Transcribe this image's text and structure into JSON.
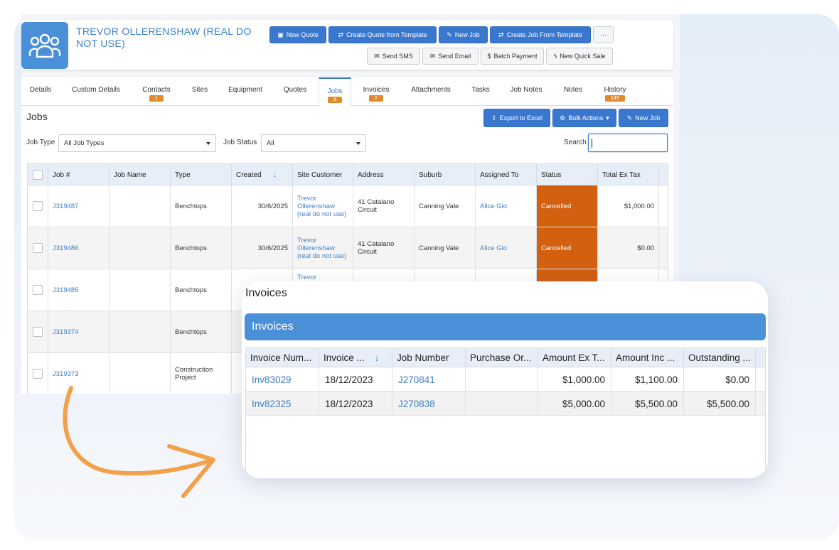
{
  "customer": {
    "name": "TREVOR OLLERENSHAW (REAL DO NOT USE)"
  },
  "header_buttons": {
    "new_quote": "New Quote",
    "create_quote_template": "Create Quote from Template",
    "new_job": "New Job",
    "create_job_template": "Create Job From Template",
    "more": "···",
    "send_sms": "Send SMS",
    "send_email": "Send Email",
    "batch_payment": "Batch Payment",
    "new_quick_sale": "New Quick Sale"
  },
  "tabs": [
    {
      "label": "Details",
      "badge": ""
    },
    {
      "label": "Custom Details",
      "badge": ""
    },
    {
      "label": "Contacts",
      "badge": "1"
    },
    {
      "label": "Sites",
      "badge": ""
    },
    {
      "label": "Equipment",
      "badge": ""
    },
    {
      "label": "Quotes",
      "badge": ""
    },
    {
      "label": "Jobs",
      "badge": "8"
    },
    {
      "label": "Invoices",
      "badge": "2"
    },
    {
      "label": "Attachments",
      "badge": ""
    },
    {
      "label": "Tasks",
      "badge": ""
    },
    {
      "label": "Job Notes",
      "badge": ""
    },
    {
      "label": "Notes",
      "badge": ""
    },
    {
      "label": "History",
      "badge": "145"
    }
  ],
  "jobs": {
    "title": "Jobs",
    "export_label": "Export to Excel",
    "bulk_label": "Bulk Actions",
    "new_job_label": "New Job",
    "filters": {
      "job_type_label": "Job Type",
      "job_type_value": "All Job Types",
      "job_status_label": "Job Status",
      "job_status_value": "All",
      "search_label": "Search"
    },
    "columns": [
      "Job #",
      "Job Name",
      "Type",
      "Created",
      "Site Customer",
      "Address",
      "Suburb",
      "Assigned To",
      "Status",
      "Total Ex Tax"
    ],
    "rows": [
      {
        "job": "J319487",
        "name": "",
        "type": "Benchtops",
        "created": "30/6/2025",
        "site": "Trevor Ollerenshaw (real do not use)",
        "address": "41 Catalano Circuit",
        "suburb": "Canning Vale",
        "assigned": "Alice Gio",
        "status": "Cancelled",
        "total": "$1,000.00"
      },
      {
        "job": "J319486",
        "name": "",
        "type": "Benchtops",
        "created": "30/6/2025",
        "site": "Trevor Ollerenshaw (real do not use)",
        "address": "41 Catalano Circuit",
        "suburb": "Canning Vale",
        "assigned": "Alice Gio",
        "status": "Cancelled",
        "total": "$0.00"
      },
      {
        "job": "J319485",
        "name": "",
        "type": "Benchtops",
        "created": "",
        "site": "Trevor",
        "address": "",
        "suburb": "",
        "assigned": "",
        "status": "",
        "total": ""
      },
      {
        "job": "J319374",
        "name": "",
        "type": "Benchtops",
        "created": "",
        "site": "",
        "address": "",
        "suburb": "",
        "assigned": "",
        "status": "",
        "total": ""
      },
      {
        "job": "J319373",
        "name": "",
        "type": "Construction Project",
        "created": "",
        "site": "",
        "address": "",
        "suburb": "",
        "assigned": "",
        "status": "",
        "total": ""
      }
    ]
  },
  "invoices": {
    "title": "Invoices",
    "bar_label": "Invoices",
    "columns": [
      "Invoice Num...",
      "Invoice ...",
      "Job Number",
      "Purchase Or...",
      "Amount Ex T...",
      "Amount Inc ...",
      "Outstanding ..."
    ],
    "rows": [
      {
        "invoice": "Inv83029",
        "date": "18/12/2023",
        "job": "J270841",
        "po": "",
        "ex": "$1,000.00",
        "inc": "$1,100.00",
        "outstanding": "$0.00"
      },
      {
        "invoice": "Inv82325",
        "date": "18/12/2023",
        "job": "J270838",
        "po": "",
        "ex": "$5,000.00",
        "inc": "$5,500.00",
        "outstanding": "$5,500.00"
      }
    ]
  },
  "colors": {
    "primary": "#3a78d0",
    "accent_orange": "#e08a2a",
    "status_cancelled": "#d2600f",
    "arrow": "#f3a04a"
  }
}
